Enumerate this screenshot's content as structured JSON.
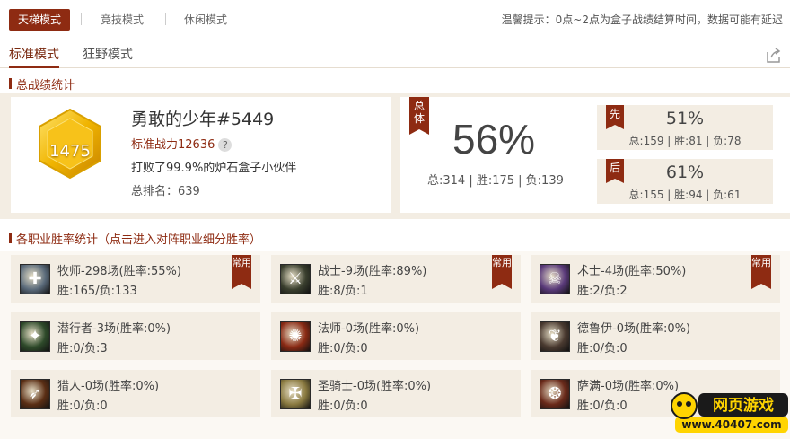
{
  "mode_tabs": [
    {
      "label": "天梯模式",
      "active": true
    },
    {
      "label": "竞技模式",
      "active": false
    },
    {
      "label": "休闲模式",
      "active": false
    }
  ],
  "tip": "温馨提示：0点~2点为盒子战绩结算时间，数据可能有延迟",
  "sub_tabs": [
    {
      "label": "标准模式",
      "active": true
    },
    {
      "label": "狂野模式",
      "active": false
    }
  ],
  "summary": {
    "section_title": "总战绩统计",
    "rank_badge_value": "1475",
    "player_name": "勇敢的少年#5449",
    "power": "标准战力12636",
    "beat": "打败了99.9%的炉石盒子小伙伴",
    "rank": "总排名：639",
    "total_ribbon": "总体",
    "total_pct": "56%",
    "total_line": "总:314 | 胜:175 | 负:139",
    "first_ribbon": "先",
    "first_pct": "51%",
    "first_line": "总:159 | 胜:81 | 负:78",
    "second_ribbon": "后",
    "second_pct": "61%",
    "second_line": "总:155 | 胜:94 | 负:61"
  },
  "classes_section_title": "各职业胜率统计（点击进入对阵职业细分胜率）",
  "badge_label": "常用",
  "classes": [
    {
      "name": "牧师-298场(胜率:55%)",
      "record": "胜:165/负:133",
      "common": true,
      "icon": "priest-icon",
      "color": "#5a6a7a"
    },
    {
      "name": "战士-9场(胜率:89%)",
      "record": "胜:8/负:1",
      "common": true,
      "icon": "warrior-icon",
      "color": "#3a3f2e"
    },
    {
      "name": "术士-4场(胜率:50%)",
      "record": "胜:2/负:2",
      "common": true,
      "icon": "warlock-icon",
      "color": "#5a3a7a"
    },
    {
      "name": "潜行者-3场(胜率:0%)",
      "record": "胜:0/负:3",
      "common": false,
      "icon": "rogue-icon",
      "color": "#2e4a2a"
    },
    {
      "name": "法师-0场(胜率:0%)",
      "record": "胜:0/负:0",
      "common": false,
      "icon": "mage-icon",
      "color": "#8a2a14"
    },
    {
      "name": "德鲁伊-0场(胜率:0%)",
      "record": "胜:0/负:0",
      "common": false,
      "icon": "druid-icon",
      "color": "#4a3a30"
    },
    {
      "name": "猎人-0场(胜率:0%)",
      "record": "胜:0/负:0",
      "common": false,
      "icon": "hunter-icon",
      "color": "#5a2e14"
    },
    {
      "name": "圣骑士-0场(胜率:0%)",
      "record": "胜:0/负:0",
      "common": false,
      "icon": "paladin-icon",
      "color": "#8a7a40"
    },
    {
      "name": "萨满-0场(胜率:0%)",
      "record": "胜:0/负:0",
      "common": false,
      "icon": "shaman-icon",
      "color": "#6a2a1a"
    }
  ],
  "watermark": {
    "line1": "网页游戏",
    "line2": "www.40407.com"
  }
}
